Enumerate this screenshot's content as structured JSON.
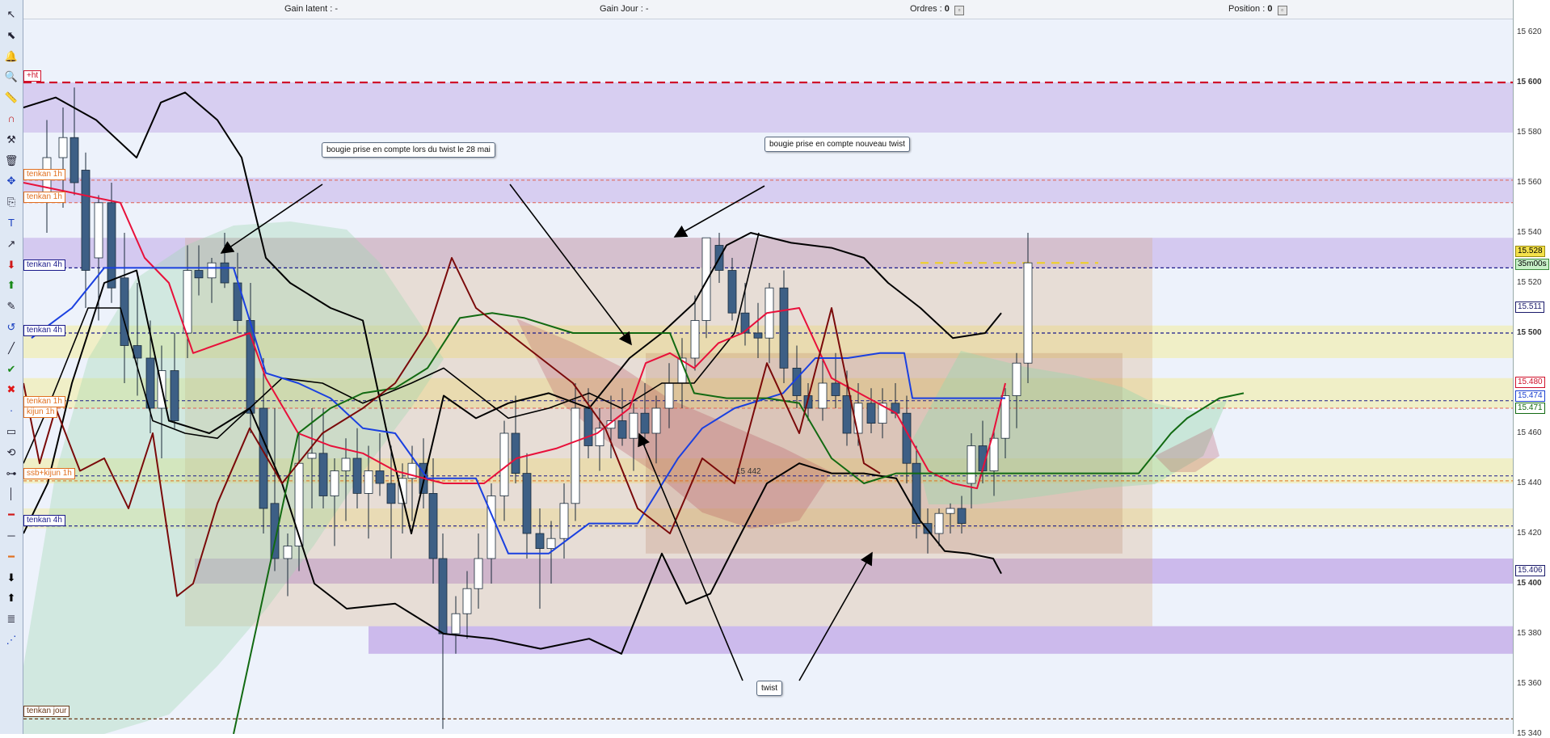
{
  "topbar": {
    "gain_latent_label": "Gain latent :",
    "gain_latent_value": "-",
    "gain_jour_label": "Gain Jour :",
    "gain_jour_value": "-",
    "ordres_label": "Ordres :",
    "ordres_value": "0",
    "position_label": "Position :",
    "position_value": "0"
  },
  "axis": {
    "ticks": [
      "15 620",
      "15 600",
      "15 580",
      "15 560",
      "15 540",
      "15 520",
      "15 500",
      "15 480",
      "15 460",
      "15 440",
      "15 420",
      "15 400",
      "15 380",
      "15 360",
      "15 340"
    ],
    "major_ticks": [
      "15 600",
      "15 500",
      "15 400"
    ],
    "price_tags": [
      {
        "text": "15.528",
        "color": "#000000",
        "bg": "#f4e14a",
        "border": "#9a8a10"
      },
      {
        "text": "35m00s",
        "color": "#000000",
        "bg": "#c8f0c8",
        "border": "#3a8a3a"
      },
      {
        "text": "15.511",
        "color": "#1a1a6a",
        "bg": "#ffffff",
        "border": "#1a1a6a"
      },
      {
        "text": "15.480",
        "color": "#d0102a",
        "bg": "#ffffff",
        "border": "#d0102a"
      },
      {
        "text": "15.474",
        "color": "#1a40d0",
        "bg": "#ffffff",
        "border": "#1a40d0"
      },
      {
        "text": "15.471",
        "color": "#126a12",
        "bg": "#ffffff",
        "border": "#126a12"
      },
      {
        "text": "15.406",
        "color": "#1a1a6a",
        "bg": "#ffffff",
        "border": "#1a1a6a"
      }
    ]
  },
  "levels": [
    {
      "text": "+ht",
      "color": "#d0102a"
    },
    {
      "text": "tenkan 1h",
      "color": "#e07020"
    },
    {
      "text": "tenkan 1h",
      "color": "#e07020"
    },
    {
      "text": "tenkan 4h",
      "color": "#1a1a8a"
    },
    {
      "text": "tenkan 4h",
      "color": "#1a1a8a"
    },
    {
      "text": "tenkan 1h",
      "color": "#e07020"
    },
    {
      "text": "kijun 1h",
      "color": "#e07020"
    },
    {
      "text": "ssb+kijun 1h",
      "color": "#e07020"
    },
    {
      "text": "tenkan 4h",
      "color": "#1a1a8a"
    },
    {
      "text": "tenkan jour",
      "color": "#6a3a1a"
    }
  ],
  "annotations": {
    "callout_1": "bougie prise en compte lors du twist le 28 mai",
    "callout_2": "bougie prise en compte  nouveau twist",
    "callout_3": "twist",
    "mid_value": "15 442"
  },
  "colors": {
    "tenkan": "#e8103a",
    "kijun": "#1a40e0",
    "chikou": "#126a12",
    "ssa": "#7a0a0a",
    "bollinger": "#000000",
    "candle_down": "#3d5f85",
    "candle_up": "#ffffff",
    "purple_zone": "#b08ce0",
    "yellow_zone": "#f6ea7a",
    "orange_zone": "#d8a878"
  },
  "toolbar_icons": [
    "cursor-icon",
    "cursor-select-icon",
    "bell-icon",
    "zoom-icon",
    "ruler-icon",
    "magnet-icon",
    "hammer-icon",
    "trash-icon",
    "move-icon",
    "copy-icon",
    "text-tool-icon",
    "arrow-diagonal-icon",
    "arrow-down-red-icon",
    "arrow-up-green-icon",
    "pencil-icon",
    "undo-icon",
    "line-tool-icon",
    "check-icon",
    "close-icon",
    "dot-icon",
    "zone-icon",
    "cycle-icon",
    "line-ends-icon",
    "vertical-line-icon",
    "horizontal-line-red-icon",
    "horizontal-line-icon",
    "horizontal-line-orange-icon",
    "arrow-down-black-icon",
    "arrow-up-black-icon",
    "layers-icon",
    "network-icon"
  ]
}
